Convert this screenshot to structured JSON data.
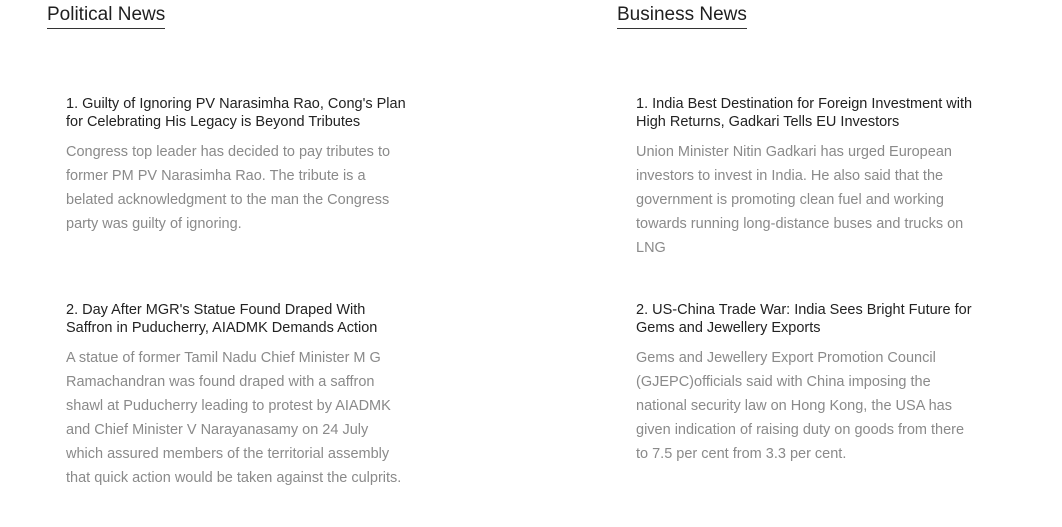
{
  "sections": [
    {
      "title": "Political News",
      "articles": [
        {
          "headline": "1. Guilty of Ignoring PV Narasimha Rao, Cong's Plan for Celebrating His Legacy is Beyond Tributes",
          "summary": "Congress top leader has decided to pay tributes to former PM PV Narasimha Rao. The tribute is a belated acknowledgment to the man the Congress party was guilty of ignoring."
        },
        {
          "headline": "2. Day After MGR's Statue Found Draped With Saffron in Puducherry, AIADMK Demands Action",
          "summary": "A statue of former Tamil Nadu Chief Minister M G Ramachandran was found draped with a saffron shawl at Puducherry leading to protest by AIADMK and Chief Minister V Narayanasamy on 24 July which assured members of the territorial assembly that quick action would be taken against the culprits."
        }
      ]
    },
    {
      "title": "Business News",
      "articles": [
        {
          "headline": "1. India Best Destination for Foreign Investment with High Returns, Gadkari Tells EU Investors",
          "summary": "Union Minister Nitin Gadkari has urged European investors to invest in India. He also said that the government is promoting clean fuel and working towards running long-distance buses and trucks on LNG"
        },
        {
          "headline": "2. US-China Trade War: India Sees Bright Future for Gems and Jewellery Exports",
          "summary": "Gems and Jewellery Export Promotion Council (GJEPC)officials said with China imposing the national security law on Hong Kong, the USA has given indication of raising duty on goods from there to 7.5 per cent from 3.3 per cent."
        }
      ]
    }
  ]
}
